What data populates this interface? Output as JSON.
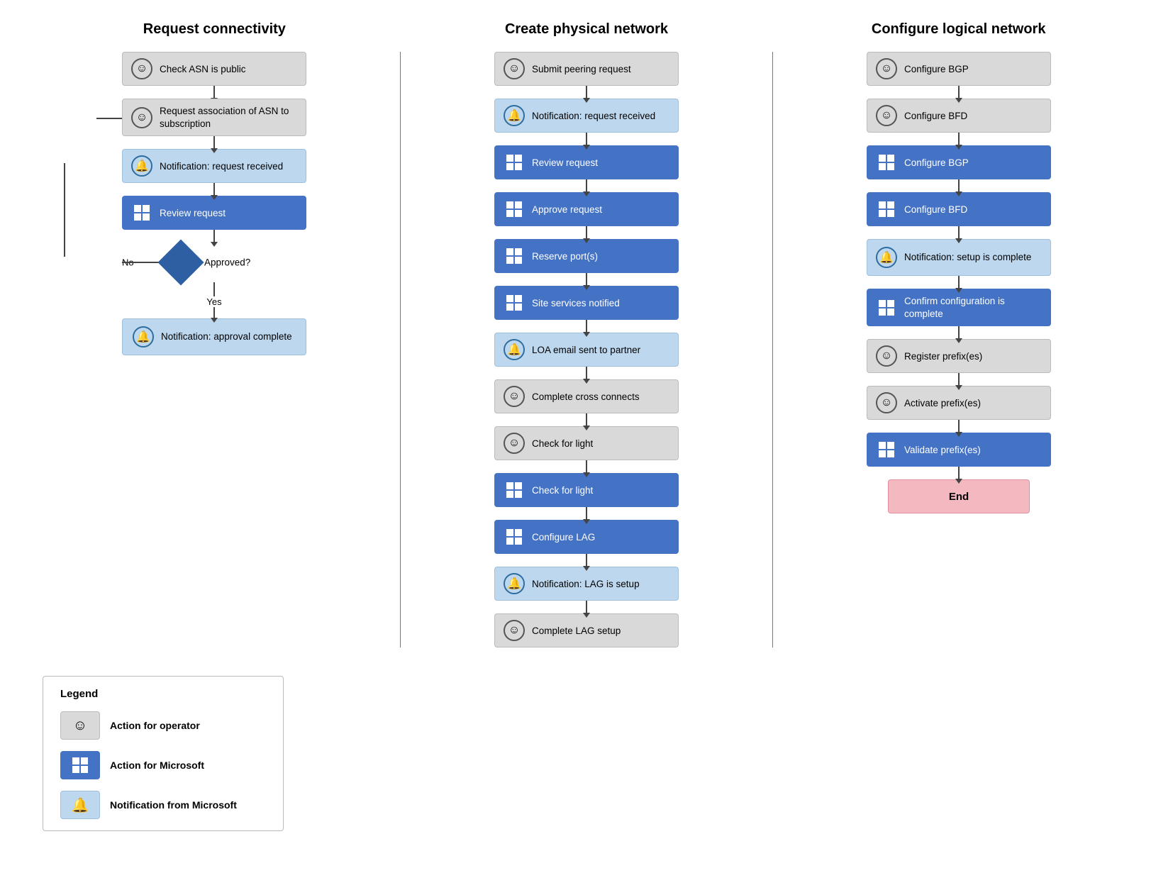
{
  "columns": [
    {
      "title": "Request connectivity",
      "nodes": [
        {
          "id": "c1n1",
          "type": "gray",
          "icon": "person",
          "text": "Check ASN is public"
        },
        {
          "id": "c1n2",
          "type": "gray",
          "icon": "person",
          "text": "Request association of ASN to subscription"
        },
        {
          "id": "c1n3",
          "type": "light-blue",
          "icon": "bell",
          "text": "Notification: request received"
        },
        {
          "id": "c1n4",
          "type": "blue",
          "icon": "ms",
          "text": "Review request"
        },
        {
          "id": "c1diamond",
          "type": "diamond",
          "text": "Approved?",
          "no": "No",
          "yes": "Yes"
        },
        {
          "id": "c1n5",
          "type": "light-blue",
          "icon": "bell",
          "text": "Notification: approval complete"
        }
      ]
    },
    {
      "title": "Create physical network",
      "nodes": [
        {
          "id": "c2n1",
          "type": "gray",
          "icon": "person",
          "text": "Submit peering request"
        },
        {
          "id": "c2n2",
          "type": "light-blue",
          "icon": "bell",
          "text": "Notification: request received"
        },
        {
          "id": "c2n3",
          "type": "blue",
          "icon": "ms",
          "text": "Review request"
        },
        {
          "id": "c2n4",
          "type": "blue",
          "icon": "ms",
          "text": "Approve request"
        },
        {
          "id": "c2n5",
          "type": "blue",
          "icon": "ms",
          "text": "Reserve port(s)"
        },
        {
          "id": "c2n6",
          "type": "blue",
          "icon": "ms",
          "text": "Site services notified"
        },
        {
          "id": "c2n7",
          "type": "light-blue",
          "icon": "bell",
          "text": "LOA email sent to partner"
        },
        {
          "id": "c2n8",
          "type": "gray",
          "icon": "person",
          "text": "Complete cross connects"
        },
        {
          "id": "c2n9",
          "type": "gray",
          "icon": "person",
          "text": "Check for light"
        },
        {
          "id": "c2n10",
          "type": "blue",
          "icon": "ms",
          "text": "Check for light"
        },
        {
          "id": "c2n11",
          "type": "blue",
          "icon": "ms",
          "text": "Configure LAG"
        },
        {
          "id": "c2n12",
          "type": "light-blue",
          "icon": "bell",
          "text": "Notification: LAG is setup"
        },
        {
          "id": "c2n13",
          "type": "gray",
          "icon": "person",
          "text": "Complete LAG setup"
        }
      ]
    },
    {
      "title": "Configure logical network",
      "nodes": [
        {
          "id": "c3n1",
          "type": "gray",
          "icon": "person",
          "text": "Configure BGP"
        },
        {
          "id": "c3n2",
          "type": "gray",
          "icon": "person",
          "text": "Configure BFD"
        },
        {
          "id": "c3n3",
          "type": "blue",
          "icon": "ms",
          "text": "Configure BGP"
        },
        {
          "id": "c3n4",
          "type": "blue",
          "icon": "ms",
          "text": "Configure BFD"
        },
        {
          "id": "c3n5",
          "type": "light-blue",
          "icon": "bell",
          "text": "Notification: setup is complete"
        },
        {
          "id": "c3n6",
          "type": "blue",
          "icon": "ms",
          "text": "Confirm configuration is complete"
        },
        {
          "id": "c3n7",
          "type": "gray",
          "icon": "person",
          "text": "Register prefix(es)"
        },
        {
          "id": "c3n8",
          "type": "gray",
          "icon": "person",
          "text": "Activate prefix(es)"
        },
        {
          "id": "c3n9",
          "type": "blue",
          "icon": "ms",
          "text": "Validate prefix(es)"
        },
        {
          "id": "c3n10",
          "type": "pink",
          "icon": "none",
          "text": "End"
        }
      ]
    }
  ],
  "legend": {
    "title": "Legend",
    "items": [
      {
        "type": "gray",
        "icon": "person",
        "label": "Action for operator"
      },
      {
        "type": "blue",
        "icon": "ms",
        "label": "Action for Microsoft"
      },
      {
        "type": "light-blue",
        "icon": "bell",
        "label": "Notification from Microsoft"
      }
    ]
  }
}
